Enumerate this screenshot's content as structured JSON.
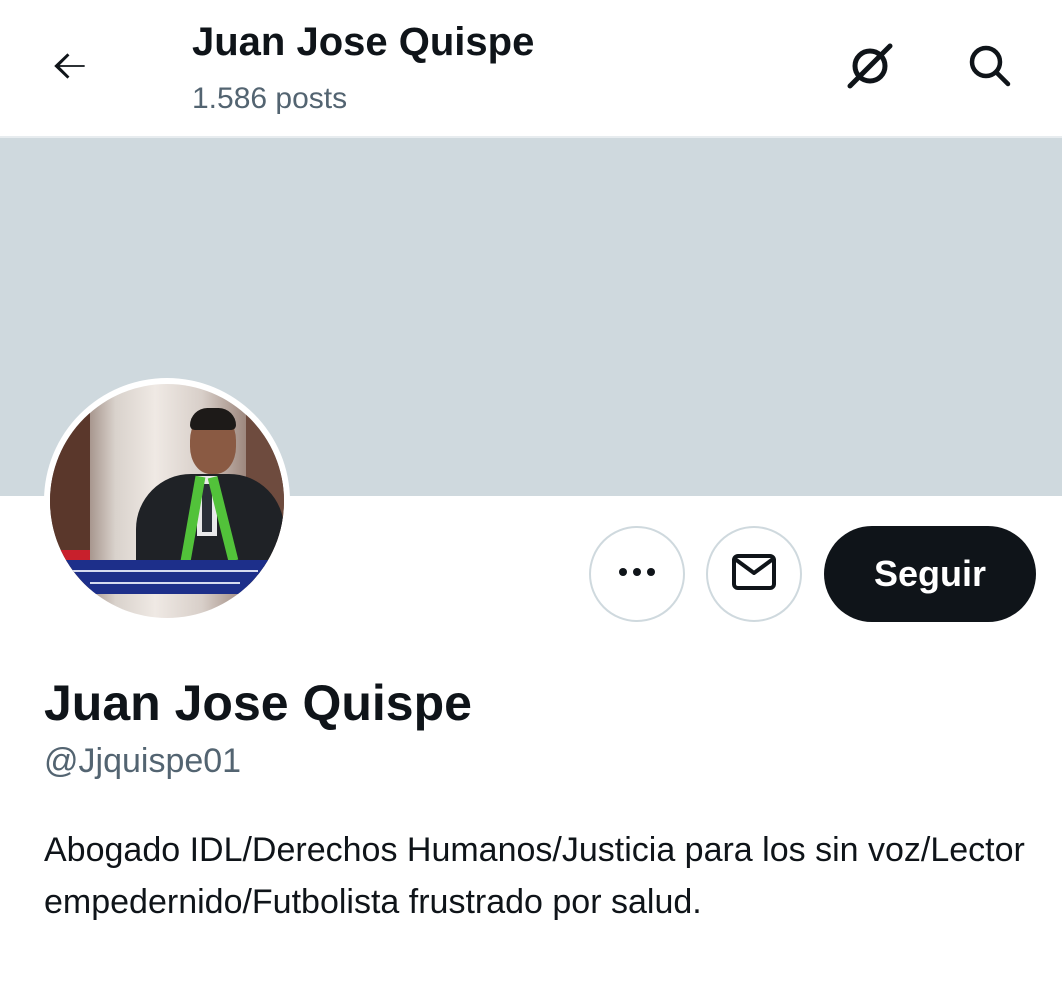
{
  "header": {
    "title": "Juan Jose Quispe",
    "post_count": "1.586 posts"
  },
  "icons": {
    "back": "arrow-left-icon",
    "grok": "grok-icon",
    "search": "search-icon",
    "more": "more-horizontal-icon",
    "message": "envelope-icon"
  },
  "actions": {
    "follow_label": "Seguir"
  },
  "profile": {
    "display_name": "Juan Jose Quispe",
    "handle": "@Jjquispe01",
    "bio": "Abogado IDL/Derechos Humanos/Justicia para los sin voz/Lector empedernido/Futbolista frustrado por salud."
  },
  "colors": {
    "banner": "#cfd9de",
    "text_primary": "#0f1419",
    "text_secondary": "#536471",
    "button_dark": "#0f1419",
    "border": "#cfd9de"
  }
}
